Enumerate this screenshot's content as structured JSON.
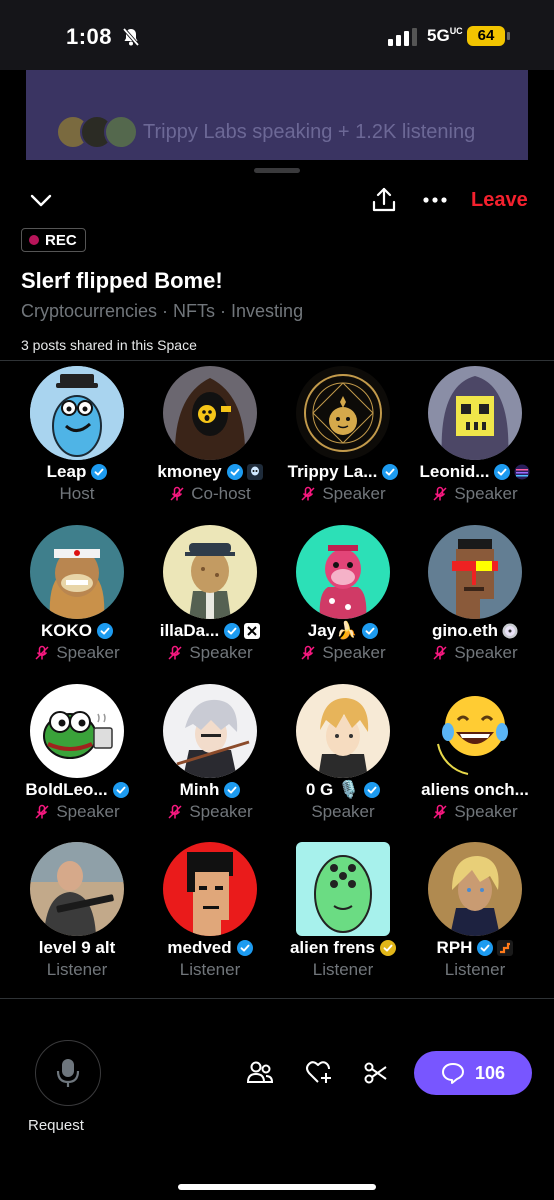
{
  "status_bar": {
    "time": "1:08",
    "network": "5G",
    "network_sub": "UC",
    "battery": "64"
  },
  "background_card": {
    "text": "Trippy Labs speaking + 1.2K listening"
  },
  "toolbar": {
    "leave_label": "Leave"
  },
  "space": {
    "rec_label": "REC",
    "title": "Slerf flipped Bome!",
    "topics": "Cryptocurrencies · NFTs · Investing",
    "posts_shared": "3 posts shared in this Space"
  },
  "participants": [
    {
      "name": "Leap",
      "role": "Host",
      "verified": "blue",
      "muted": false,
      "avatar": "blue-blob-with-hat"
    },
    {
      "name": "kmoney",
      "role": "Co-host",
      "verified": "blue",
      "muted": true,
      "avatar": "hooded-figure",
      "badge": "alien-badge"
    },
    {
      "name": "Trippy La...",
      "role": "Speaker",
      "verified": "blue",
      "muted": true,
      "avatar": "gold-circle-emblem"
    },
    {
      "name": "Leonid...",
      "role": "Speaker",
      "verified": "blue",
      "muted": true,
      "avatar": "pixel-skull",
      "badge": "sunset-badge"
    },
    {
      "name": "KOKO",
      "role": "Speaker",
      "verified": "blue",
      "muted": true,
      "avatar": "ape-bandana"
    },
    {
      "name": "illaDa...",
      "role": "Speaker",
      "verified": "blue",
      "muted": true,
      "avatar": "giraffe-ape-suit",
      "badge": "x-badge"
    },
    {
      "name": "Jay🍌",
      "role": "Speaker",
      "verified": "blue",
      "muted": true,
      "avatar": "pink-ape"
    },
    {
      "name": "gino.eth",
      "role": "Speaker",
      "verified": "none",
      "muted": true,
      "avatar": "pixel-punk-visor",
      "badge": "disc-badge"
    },
    {
      "name": "BoldLeo...",
      "role": "Speaker",
      "verified": "blue",
      "muted": true,
      "avatar": "pepe-frog-mug"
    },
    {
      "name": "Minh",
      "role": "Speaker",
      "verified": "blue",
      "muted": true,
      "avatar": "anime-white-hair"
    },
    {
      "name": "0 G 🎙️",
      "role": "Speaker",
      "verified": "blue",
      "muted": false,
      "avatar": "anime-blond"
    },
    {
      "name": "aliens onch...",
      "role": "Speaker",
      "verified": "none",
      "muted": true,
      "avatar": "laughing-emoji"
    },
    {
      "name": "level 9 alt",
      "role": "Listener",
      "verified": "none",
      "muted": false,
      "avatar": "man-with-rifle"
    },
    {
      "name": "medved",
      "role": "Listener",
      "verified": "blue",
      "muted": false,
      "avatar": "pixel-punk-red"
    },
    {
      "name": "alien frens",
      "role": "Listener",
      "verified": "gold",
      "muted": false,
      "avatar": "green-alien"
    },
    {
      "name": "RPH",
      "role": "Listener",
      "verified": "blue",
      "muted": false,
      "avatar": "anime-blond-uniform",
      "badge": "stairs-badge"
    }
  ],
  "bottom_bar": {
    "request_label": "Request",
    "comment_count": "106"
  },
  "colors": {
    "accent": "#7856ff",
    "leave": "#f4212e",
    "verified_blue": "#1d9bf0",
    "verified_gold": "#e2b719",
    "muted_pink": "#f91880",
    "rec_dot": "#b8155a"
  }
}
